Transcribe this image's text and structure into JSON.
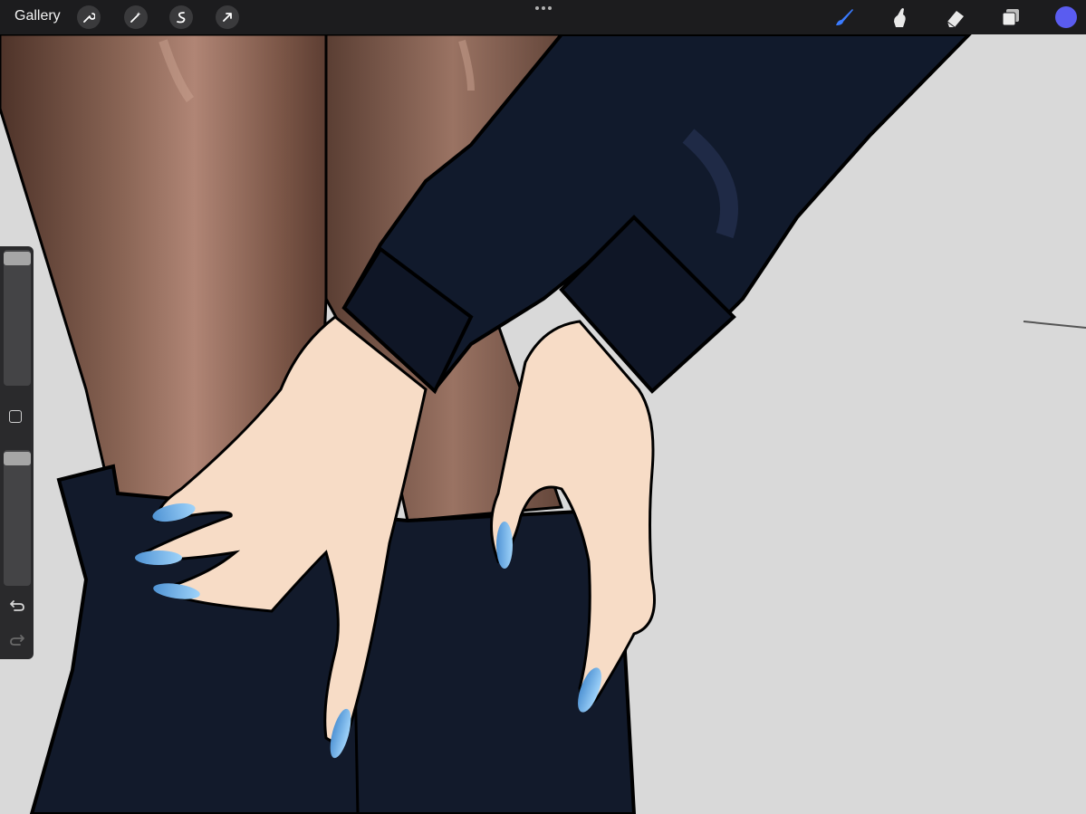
{
  "toolbar": {
    "gallery_label": "Gallery",
    "left_tools": [
      "wrench-icon",
      "magic-wand-icon",
      "selection-icon",
      "transform-arrow-icon"
    ],
    "right_tools": [
      "brush-icon",
      "smudge-icon",
      "eraser-icon",
      "layers-icon"
    ],
    "active_tool": "brush",
    "current_color": "#5a5cf0"
  },
  "sidebar": {
    "brush_size_level": 1.0,
    "opacity_level": 1.0,
    "controls": [
      "modify-button",
      "undo-icon",
      "redo-icon"
    ]
  },
  "colors": {
    "canvas_bg": "#d9d9d9",
    "stocking": "#7a5a4a",
    "clothing": "#121a2b",
    "skin": "#f6d9c4",
    "nails": "#78b8ec"
  }
}
